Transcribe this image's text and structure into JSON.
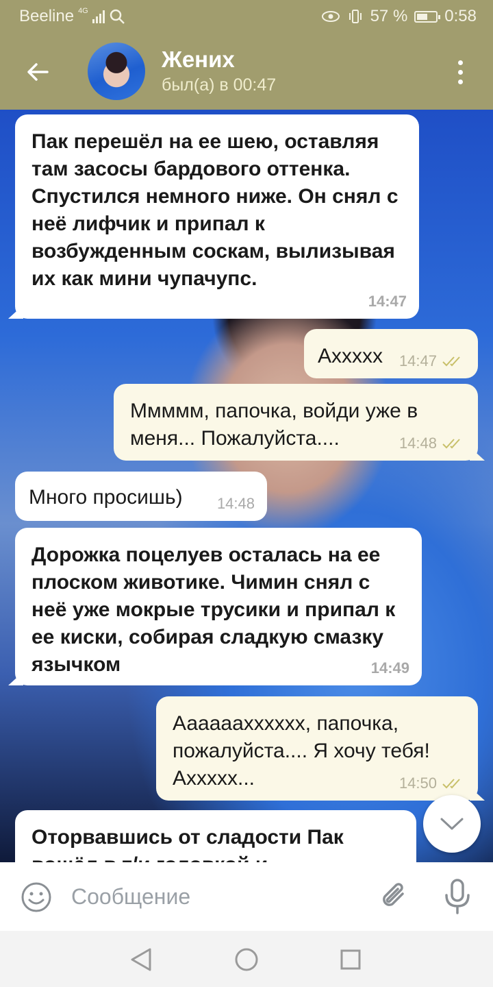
{
  "status_bar": {
    "carrier": "Beeline",
    "network": "4G",
    "battery_percent": "57 %",
    "battery_level": 0.57,
    "time": "0:58"
  },
  "header": {
    "contact_name": "Жених",
    "last_seen": "был(а) в 00:47"
  },
  "messages": [
    {
      "dir": "in",
      "bold": true,
      "text": "Пак перешёл на ее шею, оставляя там засосы бардового оттенка. Спустился немного ниже. Он снял с неё лифчик и припал к возбужденным соскам, вылизывая их как мини чупачупс.",
      "time": "14:47",
      "read": false
    },
    {
      "dir": "out",
      "bold": false,
      "text": "Ахххxx",
      "time": "14:47",
      "read": true
    },
    {
      "dir": "out",
      "bold": false,
      "text": "Ммммм, папочка, войди уже в меня... Пожалуйста....",
      "time": "14:48",
      "read": true
    },
    {
      "dir": "in",
      "bold": false,
      "text": "Много просишь)",
      "time": "14:48",
      "read": false
    },
    {
      "dir": "in",
      "bold": true,
      "text": "Дорожка поцелуев осталась на ее плоском животике. Чимин снял с неё уже мокрые трусики и припал к ее киски, собирая сладкую смазку язычком",
      "time": "14:49",
      "read": false
    },
    {
      "dir": "out",
      "bold": false,
      "text": "Ааааааxxxxxx, папочка, пожалуйста.... Я хочу тебя! Ахххxx...",
      "time": "14:50",
      "read": true
    },
    {
      "dir": "in",
      "bold": true,
      "text": "Оторвавшись от сладости Пак вошёл в т/и головкой и",
      "time": "",
      "read": false
    }
  ],
  "composer": {
    "placeholder": "Сообщение"
  },
  "icons": {
    "back": "back-arrow-icon",
    "menu": "more-vert-icon",
    "emoji": "smile-icon",
    "attach": "paperclip-icon",
    "mic": "microphone-icon",
    "scroll": "chevron-down-icon"
  },
  "colors": {
    "header": "#a19d6e",
    "incoming": "#ffffff",
    "outgoing": "#fbf8e7",
    "check": "#c8c06a"
  }
}
